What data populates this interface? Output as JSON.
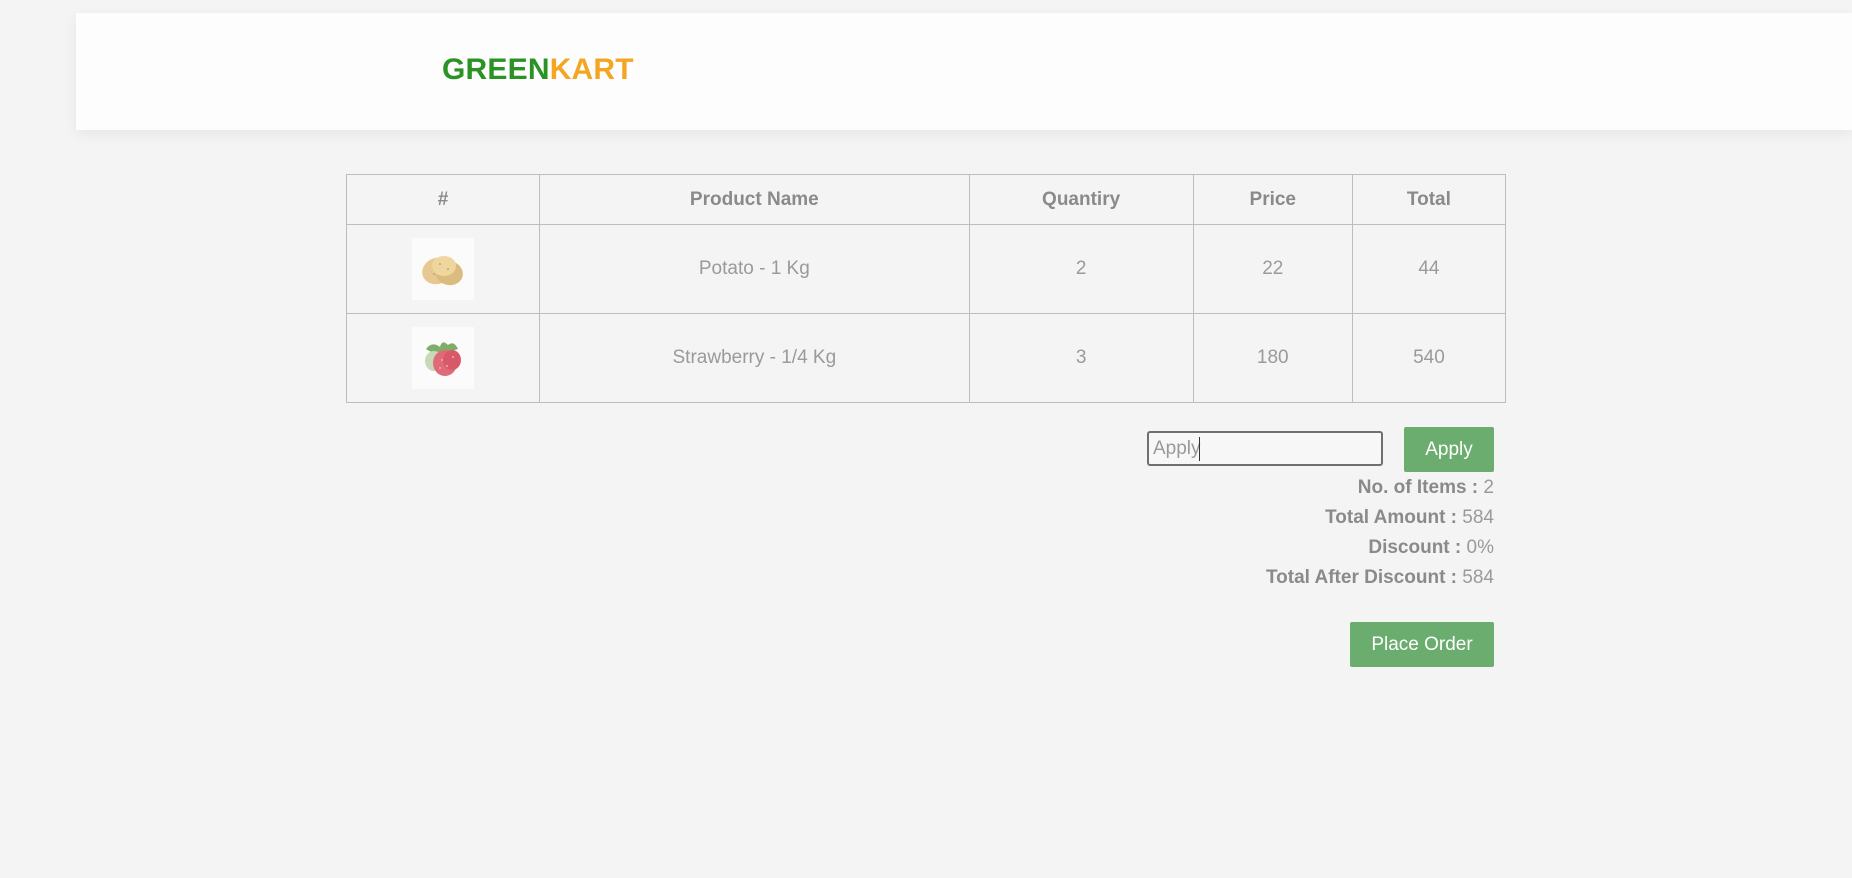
{
  "brand": {
    "part1": "GREEN",
    "part2": "KART",
    "color1": "#2b9226",
    "color2": "#f4a623"
  },
  "table": {
    "headers": {
      "image": "#",
      "name": "Product Name",
      "quantity": "Quantiry",
      "price": "Price",
      "total": "Total"
    },
    "rows": [
      {
        "icon": "potato-image",
        "name": "Potato - 1 Kg",
        "quantity": "2",
        "price": "22",
        "total": "44"
      },
      {
        "icon": "strawberry-image",
        "name": "Strawberry - 1/4 Kg",
        "quantity": "3",
        "price": "180",
        "total": "540"
      }
    ]
  },
  "promo": {
    "placeholder": "Apply",
    "value": "",
    "apply_label": "Apply"
  },
  "summary": {
    "items_label": "No. of Items :",
    "items_value": "2",
    "amount_label": "Total Amount :",
    "amount_value": "584",
    "discount_label": "Discount :",
    "discount_value": "0%",
    "after_label": "Total After Discount :",
    "after_value": "584"
  },
  "place_order_label": "Place Order",
  "colors": {
    "accent_button": "#6aad6e",
    "background": "#f4f4f4"
  }
}
